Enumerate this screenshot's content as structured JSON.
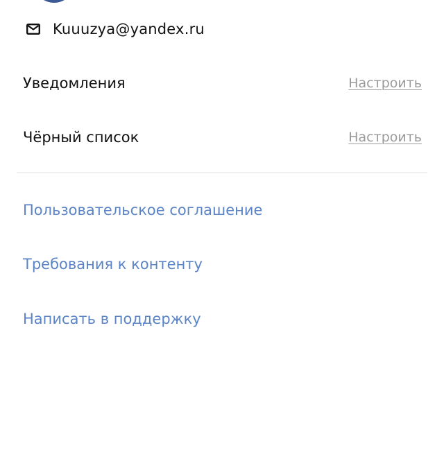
{
  "profile": {
    "avatar_icon": "avatar",
    "email_icon": "mail-icon",
    "email": "Kuuuzya@yandex.ru"
  },
  "settings": [
    {
      "label": "Уведомления",
      "action": "Настроить"
    },
    {
      "label": "Чёрный список",
      "action": "Настроить"
    }
  ],
  "links": [
    {
      "label": "Пользовательское соглашение"
    },
    {
      "label": "Требования к контенту"
    },
    {
      "label": "Написать в поддержку"
    }
  ],
  "colors": {
    "text": "#111111",
    "link": "#5b84c6",
    "muted": "#9a9a9a",
    "divider": "#efefef",
    "avatar": "#3c5a96"
  }
}
